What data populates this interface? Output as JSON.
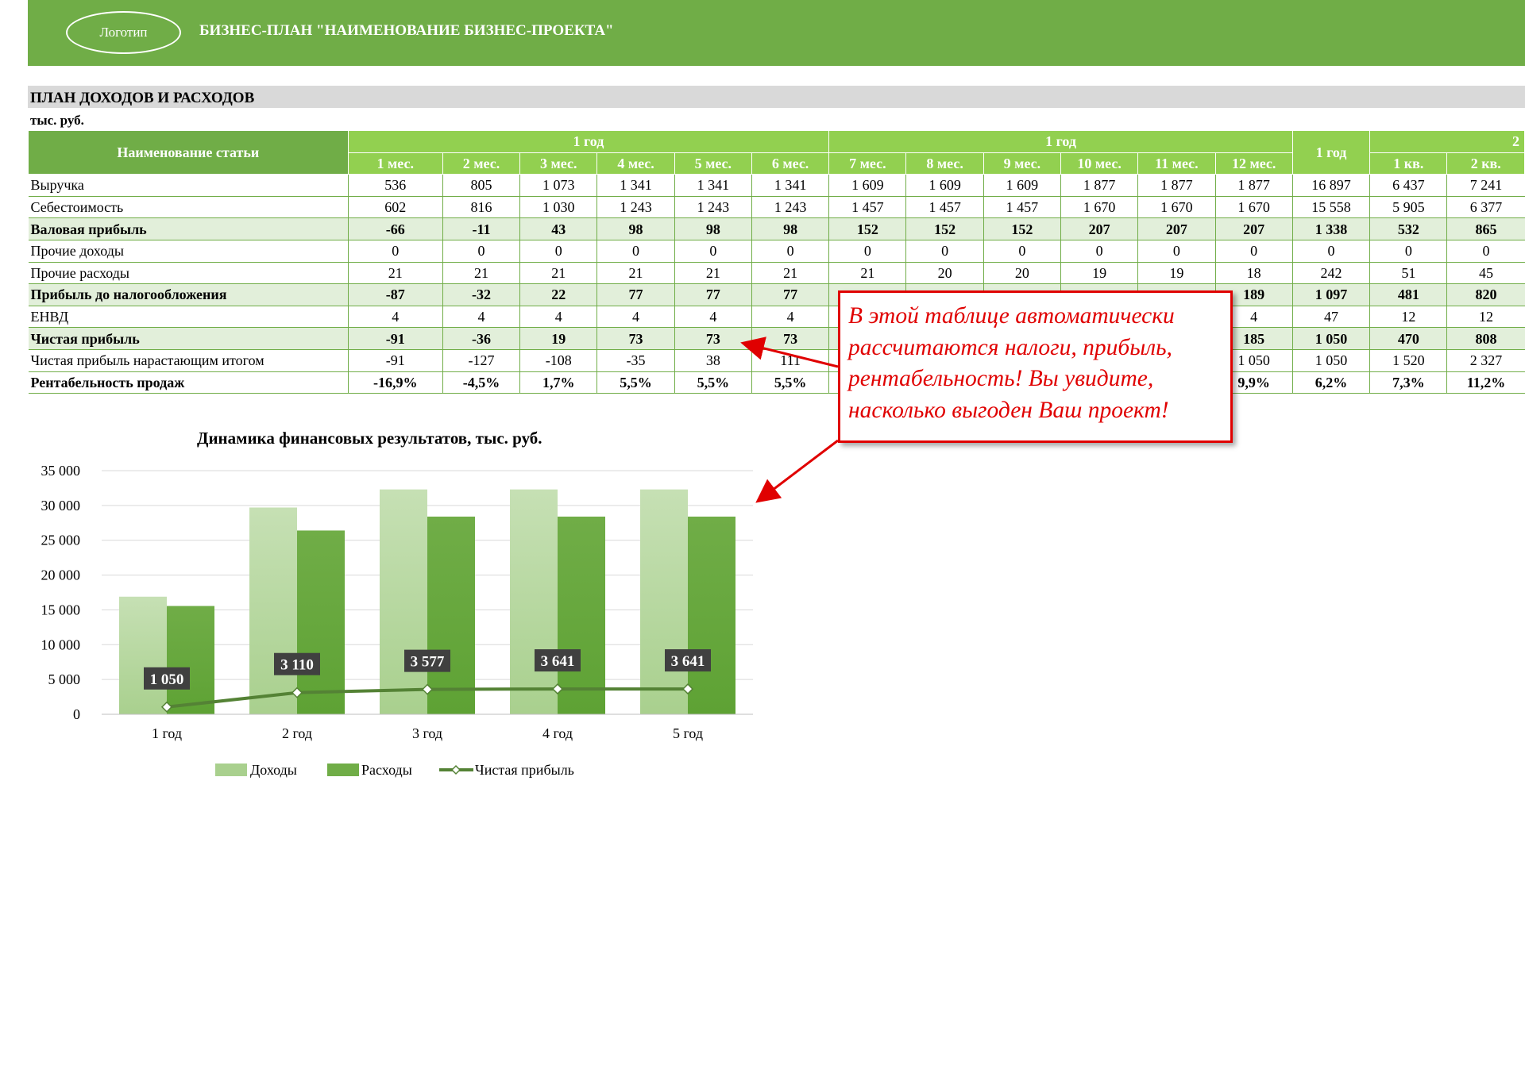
{
  "header": {
    "logo": "Логотип",
    "title": "БИЗНЕС-ПЛАН \"НАИМЕНОВАНИЕ БИЗНЕС-ПРОЕКТА\""
  },
  "section": {
    "title": "ПЛАН ДОХОДОВ И РАСХОДОВ",
    "units": "тыс. руб."
  },
  "table": {
    "name_header": "Наименование статьи",
    "group_1": "1 год",
    "group_2": "1 год",
    "total_header": "1 год",
    "group_3": "2",
    "months": [
      "1 мес.",
      "2 мес.",
      "3 мес.",
      "4 мес.",
      "5 мес.",
      "6 мес.",
      "7 мес.",
      "8 мес.",
      "9 мес.",
      "10 мес.",
      "11 мес.",
      "12 мес."
    ],
    "quarters": [
      "1 кв.",
      "2 кв."
    ],
    "rows": [
      {
        "name": "Выручка",
        "bold": false,
        "v": [
          "536",
          "805",
          "1 073",
          "1 341",
          "1 341",
          "1 341",
          "1 609",
          "1 609",
          "1 609",
          "1 877",
          "1 877",
          "1 877",
          "16 897",
          "6 437",
          "7 241"
        ]
      },
      {
        "name": "Себестоимость",
        "bold": false,
        "v": [
          "602",
          "816",
          "1 030",
          "1 243",
          "1 243",
          "1 243",
          "1 457",
          "1 457",
          "1 457",
          "1 670",
          "1 670",
          "1 670",
          "15 558",
          "5 905",
          "6 377"
        ]
      },
      {
        "name": "Валовая прибыль",
        "bold": true,
        "v": [
          "-66",
          "-11",
          "43",
          "98",
          "98",
          "98",
          "152",
          "152",
          "152",
          "207",
          "207",
          "207",
          "1 338",
          "532",
          "865"
        ]
      },
      {
        "name": "Прочие доходы",
        "bold": false,
        "v": [
          "0",
          "0",
          "0",
          "0",
          "0",
          "0",
          "0",
          "0",
          "0",
          "0",
          "0",
          "0",
          "0",
          "0",
          "0"
        ]
      },
      {
        "name": "Прочие расходы",
        "bold": false,
        "v": [
          "21",
          "21",
          "21",
          "21",
          "21",
          "21",
          "21",
          "20",
          "20",
          "19",
          "19",
          "18",
          "242",
          "51",
          "45"
        ]
      },
      {
        "name": "Прибыль до налогообложения",
        "bold": true,
        "v": [
          "-87",
          "-32",
          "22",
          "77",
          "77",
          "77",
          "",
          "",
          "",
          "",
          "",
          "189",
          "1 097",
          "481",
          "820"
        ]
      },
      {
        "name": "ЕНВД",
        "bold": false,
        "v": [
          "4",
          "4",
          "4",
          "4",
          "4",
          "4",
          "",
          "",
          "",
          "",
          "",
          "4",
          "47",
          "12",
          "12"
        ]
      },
      {
        "name": "Чистая прибыль",
        "bold": true,
        "v": [
          "-91",
          "-36",
          "19",
          "73",
          "73",
          "73",
          "",
          "",
          "",
          "",
          "",
          "185",
          "1 050",
          "470",
          "808"
        ]
      },
      {
        "name": "Чистая прибыль нарастающим итогом",
        "bold": false,
        "v": [
          "-91",
          "-127",
          "-108",
          "-35",
          "38",
          "111",
          "",
          "",
          "",
          "",
          "",
          "1 050",
          "1 050",
          "1 520",
          "2 327"
        ]
      },
      {
        "name": "Рентабельность продаж",
        "bold": true,
        "v": [
          "-16,9%",
          "-4,5%",
          "1,7%",
          "5,5%",
          "5,5%",
          "5,5%",
          "",
          "",
          "",
          "",
          "",
          "9,9%",
          "6,2%",
          "7,3%",
          "11,2%"
        ]
      }
    ]
  },
  "callout": {
    "text": "В этой таблице автоматически рассчитаются налоги, прибыль, рентабельность! Вы увидите, насколько выгоден Ваш проект!",
    "color": "#e00000"
  },
  "colors": {
    "header_green": "#70ad47",
    "table_header_green": "#92d050",
    "income_bar": "#a9d08e",
    "expense_bar": "#70ad47",
    "profit_line": "#548235"
  },
  "chart_data": {
    "type": "bar",
    "title": "Динамика  финансовых результатов, тыс. руб.",
    "categories": [
      "1 год",
      "2 год",
      "3 год",
      "4 год",
      "5 год"
    ],
    "series": [
      {
        "name": "Доходы",
        "type": "bar",
        "values": [
          16897,
          29700,
          32300,
          32300,
          32300
        ]
      },
      {
        "name": "Расходы",
        "type": "bar",
        "values": [
          15558,
          26400,
          28400,
          28400,
          28400
        ]
      },
      {
        "name": "Чистая прибыль",
        "type": "line",
        "values": [
          1050,
          3110,
          3577,
          3641,
          3641
        ],
        "labels": [
          "1 050",
          "3 110",
          "3 577",
          "3 641",
          "3 641"
        ]
      }
    ],
    "ylim": [
      0,
      35000
    ],
    "yticks": [
      "0",
      "5 000",
      "10 000",
      "15 000",
      "20 000",
      "25 000",
      "30 000",
      "35 000"
    ],
    "grid": true,
    "legend": "bottom"
  }
}
